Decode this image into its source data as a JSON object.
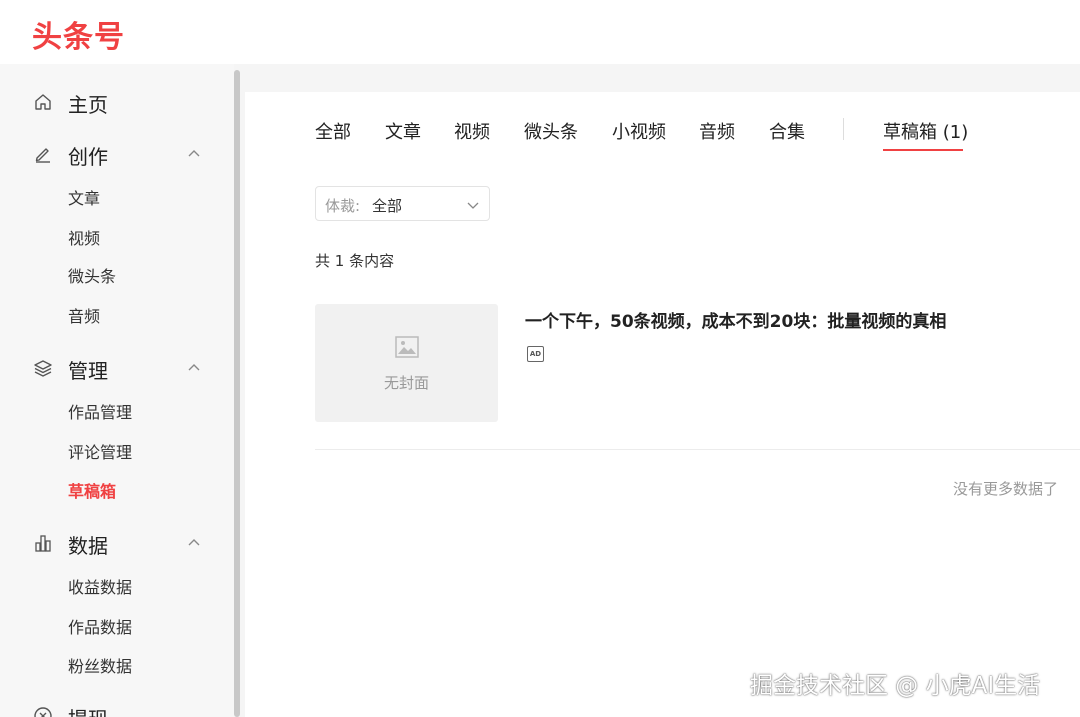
{
  "brand": {
    "logo_text": "头条号",
    "accent_color": "#f04142"
  },
  "sidebar": {
    "home": {
      "label": "主页",
      "icon": "home-icon"
    },
    "create": {
      "label": "创作",
      "icon": "pen-icon",
      "items": [
        "文章",
        "视频",
        "微头条",
        "音频"
      ]
    },
    "manage": {
      "label": "管理",
      "icon": "layers-icon",
      "items": [
        "作品管理",
        "评论管理",
        "草稿箱"
      ],
      "active_item": "草稿箱"
    },
    "data": {
      "label": "数据",
      "icon": "bar-chart-icon",
      "items": [
        "收益数据",
        "作品数据",
        "粉丝数据"
      ]
    },
    "withdraw": {
      "label": "提现",
      "icon": "withdraw-icon"
    }
  },
  "tabs": [
    "全部",
    "文章",
    "视频",
    "微头条",
    "小视频",
    "音频",
    "合集",
    "草稿箱 (1)"
  ],
  "active_tab": "草稿箱 (1)",
  "filter": {
    "label": "体裁:",
    "value": "全部"
  },
  "count_text": "共 1 条内容",
  "items": [
    {
      "title": "一个下午，50条视频，成本不到20块：批量视频的真相",
      "cover_text": "无封面",
      "badge": "AD"
    }
  ],
  "footer_text": "没有更多数据了",
  "watermark": "掘金技术社区 @ 小虎AI生活"
}
